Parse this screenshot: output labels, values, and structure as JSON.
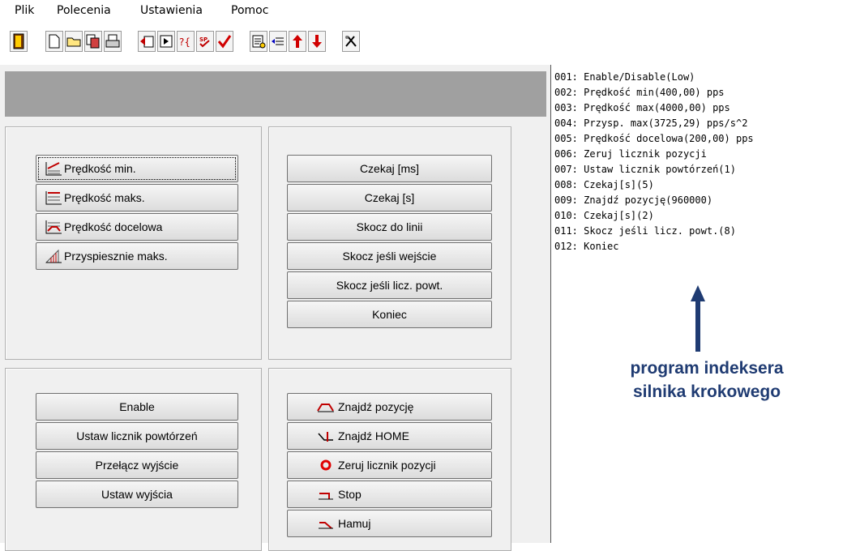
{
  "menu": [
    "Plik",
    "Polecenia",
    "Ustawienia",
    "Pomoc"
  ],
  "toolbar": [
    "exit-icon",
    "new-icon",
    "open-icon",
    "save-icon",
    "print-icon",
    "insert-line-icon",
    "run-icon",
    "help-brace-icon",
    "spellcheck-icon",
    "check-icon",
    "compile-icon",
    "renumber-icon",
    "move-up-icon",
    "move-down-icon",
    "settings-icon"
  ],
  "speed_group": {
    "buttons": [
      "Prędkość min.",
      "Prędkość maks.",
      "Prędkość docelowa",
      "Przyspiesznie maks."
    ]
  },
  "flow_group": {
    "buttons": [
      "Czekaj [ms]",
      "Czekaj [s]",
      "Skocz do linii",
      "Skocz jeśli wejście",
      "Skocz jeśli licz. powt.",
      "Koniec"
    ]
  },
  "io_group": {
    "buttons": [
      "Enable",
      "Ustaw licznik powtórzeń",
      "Przełącz wyjście",
      "Ustaw wyjścia"
    ]
  },
  "motion_group": {
    "buttons": [
      "Znajdź pozycję",
      "Znajdź HOME",
      "Zeruj licznik pozycji",
      "Stop",
      "Hamuj"
    ]
  },
  "program_lines": [
    "001: Enable/Disable(Low)",
    "002: Prędkość min(400,00) pps",
    "003: Prędkość max(4000,00) pps",
    "004: Przysp. max(3725,29) pps/s^2",
    "005: Prędkość docelowa(200,00) pps",
    "006: Zeruj licznik pozycji",
    "007: Ustaw licznik powtórzeń(1)",
    "008: Czekaj[s](5)",
    "009: Znajdź pozycję(960000)",
    "010: Czekaj[s](2)",
    "011: Skocz jeśli licz. powt.(8)",
    "012: Koniec"
  ],
  "annotation": {
    "line1": "program indeksera",
    "line2": "silnika krokowego",
    "color": "#1f3b72"
  }
}
